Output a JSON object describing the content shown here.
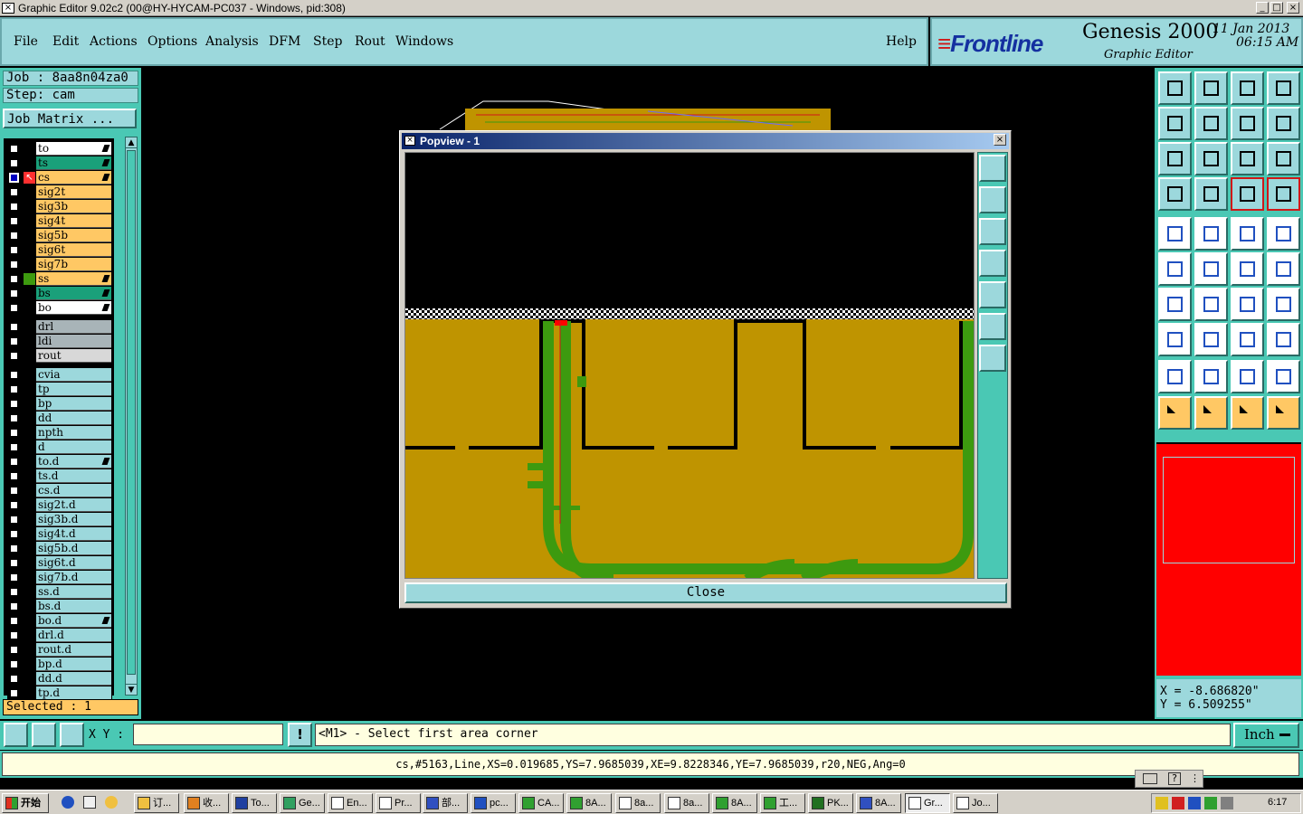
{
  "window": {
    "title": "Graphic Editor 9.02c2 (00@HY-HYCAM-PC037 - Windows, pid:308)"
  },
  "menu": {
    "items": [
      "File",
      "Edit",
      "Actions",
      "Options",
      "Analysis",
      "DFM",
      "Step",
      "Rout",
      "Windows"
    ],
    "help": "Help"
  },
  "brand": {
    "logo": "Frontline",
    "product": "Genesis 2000",
    "subtitle": "Graphic Editor",
    "date": "11 Jan 2013",
    "time": "06:15 AM"
  },
  "job": {
    "job_label": "Job : 8aa8n04za0",
    "step_label": "Step: cam",
    "matrix_button": "Job Matrix ...",
    "selected": "Selected : 1"
  },
  "layers": {
    "board": [
      {
        "name": "to",
        "color": "#ffffff",
        "mark": true
      },
      {
        "name": "ts",
        "color": "#1aa07a",
        "mark": true
      },
      {
        "name": "cs",
        "color": "#ffc864",
        "mark": true,
        "active": true
      },
      {
        "name": "sig2t",
        "color": "#ffc864"
      },
      {
        "name": "sig3b",
        "color": "#ffc864"
      },
      {
        "name": "sig4t",
        "color": "#ffc864"
      },
      {
        "name": "sig5b",
        "color": "#ffc864"
      },
      {
        "name": "sig6t",
        "color": "#ffc864"
      },
      {
        "name": "sig7b",
        "color": "#ffc864"
      },
      {
        "name": "ss",
        "color": "#ffc864",
        "mark": true,
        "green": true
      },
      {
        "name": "bs",
        "color": "#1aa07a",
        "mark": true
      },
      {
        "name": "bo",
        "color": "#ffffff",
        "mark": true
      }
    ],
    "drill": [
      {
        "name": "drl",
        "color": "#a8b4b8"
      },
      {
        "name": "ldi",
        "color": "#a8b4b8"
      },
      {
        "name": "rout",
        "color": "#d8d8d8"
      }
    ],
    "misc": [
      {
        "name": "cvia"
      },
      {
        "name": "tp"
      },
      {
        "name": "bp"
      },
      {
        "name": "dd"
      },
      {
        "name": "npth"
      },
      {
        "name": "d"
      },
      {
        "name": "to.d",
        "mark": true
      },
      {
        "name": "ts.d"
      },
      {
        "name": "cs.d"
      },
      {
        "name": "sig2t.d"
      },
      {
        "name": "sig3b.d"
      },
      {
        "name": "sig4t.d"
      },
      {
        "name": "sig5b.d"
      },
      {
        "name": "sig6t.d"
      },
      {
        "name": "sig7b.d"
      },
      {
        "name": "ss.d"
      },
      {
        "name": "bs.d"
      },
      {
        "name": "bo.d",
        "mark": true
      },
      {
        "name": "drl.d"
      },
      {
        "name": "rout.d"
      },
      {
        "name": "bp.d"
      },
      {
        "name": "dd.d"
      },
      {
        "name": "tp.d"
      }
    ]
  },
  "popview": {
    "title": "Popview - 1",
    "close_label": "Close"
  },
  "coords": {
    "x": "X = -8.686820\"",
    "y": "Y = 6.509255\""
  },
  "command": {
    "xy_label": "X Y :",
    "xy_value": "",
    "prompt": "<M1> - Select first area corner",
    "unit": "Inch"
  },
  "status": {
    "text": "cs,#5163,Line,XS=0.019685,YS=7.9685039,XE=9.8228346,YE=7.9685039,r20,NEG,Ang=0"
  },
  "taskbar": {
    "start": "开始",
    "tasks": [
      "订...",
      "收...",
      "To...",
      "Ge...",
      "En...",
      "Pr...",
      "部...",
      "pc...",
      "CA...",
      "8A...",
      "8a...",
      "8a...",
      "8A...",
      "工...",
      "PK...",
      "8A...",
      "Gr...",
      "Jo..."
    ],
    "clock": "6:17"
  },
  "colors": {
    "panel": "#4ac8b4",
    "menubar": "#9cd8dc",
    "copper": "#bf9400",
    "trace": "#3d9a0f",
    "highlight": "#ff0000"
  }
}
